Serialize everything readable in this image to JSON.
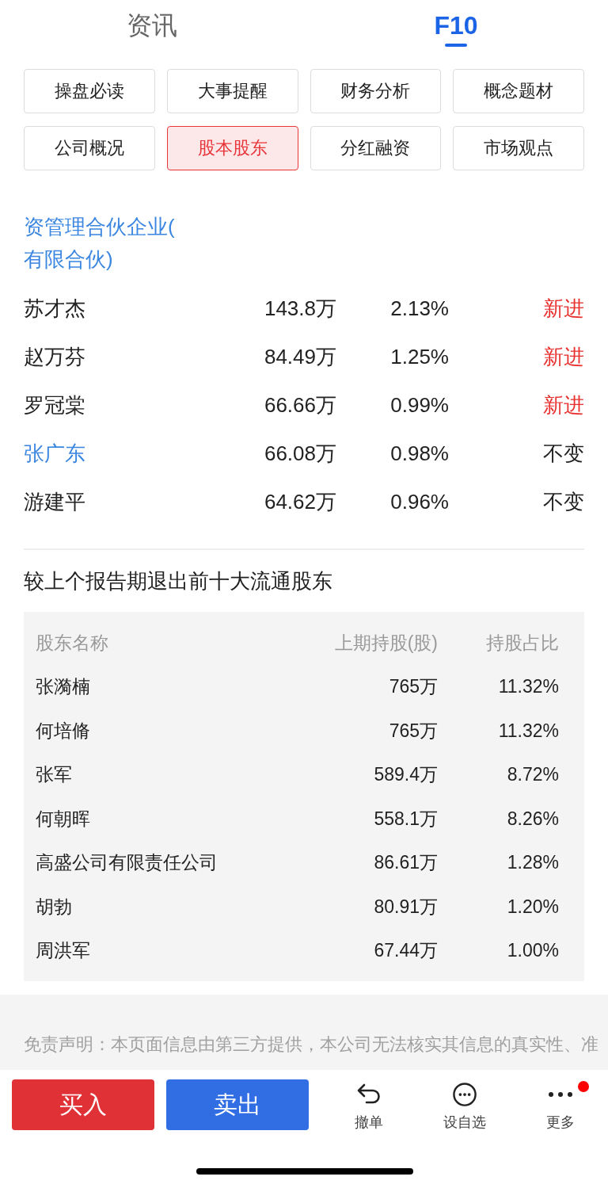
{
  "top_tabs": [
    {
      "label": "资讯",
      "selected": false
    },
    {
      "label": "F10",
      "selected": true
    }
  ],
  "section_buttons": [
    {
      "label": "操盘必读",
      "selected": false
    },
    {
      "label": "大事提醒",
      "selected": false
    },
    {
      "label": "财务分析",
      "selected": false
    },
    {
      "label": "概念题材",
      "selected": false
    },
    {
      "label": "公司概况",
      "selected": false
    },
    {
      "label": "股本股东",
      "selected": true
    },
    {
      "label": "分红融资",
      "selected": false
    },
    {
      "label": "市场观点",
      "selected": false
    }
  ],
  "shareholders": [
    {
      "name": "资管理合伙企业(有限合伙)",
      "link": true
    },
    {
      "name": "苏才杰",
      "link": false,
      "shares": "143.8万",
      "ratio": "2.13%",
      "change": "新进",
      "highlighted": true
    },
    {
      "name": "赵万芬",
      "link": false,
      "shares": "84.49万",
      "ratio": "1.25%",
      "change": "新进",
      "highlighted": true
    },
    {
      "name": "罗冠棠",
      "link": false,
      "shares": "66.66万",
      "ratio": "0.99%",
      "change": "新进",
      "highlighted": true
    },
    {
      "name": "张广东",
      "link": true,
      "shares": "66.08万",
      "ratio": "0.98%",
      "change": "不变",
      "highlighted": false
    },
    {
      "name": "游建平",
      "link": false,
      "shares": "64.62万",
      "ratio": "0.96%",
      "change": "不变",
      "highlighted": false
    }
  ],
  "exited_section": {
    "title": "较上个报告期退出前十大流通股东",
    "columns": [
      "股东名称",
      "上期持股(股)",
      "持股占比"
    ],
    "rows": [
      {
        "name": "张漪楠",
        "shares": "765万",
        "ratio": "11.32%"
      },
      {
        "name": "何培脩",
        "shares": "765万",
        "ratio": "11.32%"
      },
      {
        "name": "张军",
        "shares": "589.4万",
        "ratio": "8.72%"
      },
      {
        "name": "何朝晖",
        "shares": "558.1万",
        "ratio": "8.26%"
      },
      {
        "name": "高盛公司有限责任公司",
        "shares": "86.61万",
        "ratio": "1.28%"
      },
      {
        "name": "胡勃",
        "shares": "80.91万",
        "ratio": "1.20%"
      },
      {
        "name": "周洪军",
        "shares": "67.44万",
        "ratio": "1.00%"
      }
    ]
  },
  "disclaimer": "免责声明：本页面信息由第三方提供，本公司无法核实其信息的真实性、准",
  "trade_buttons": [
    {
      "label": "买入",
      "kind": "buy"
    },
    {
      "label": "卖出",
      "kind": "sell"
    }
  ],
  "toolbar": [
    {
      "label": "撤单",
      "kind": "undo",
      "badge": false
    },
    {
      "label": "设自选",
      "kind": "watchlist",
      "badge": false
    },
    {
      "label": "更多",
      "kind": "more",
      "badge": true
    }
  ]
}
